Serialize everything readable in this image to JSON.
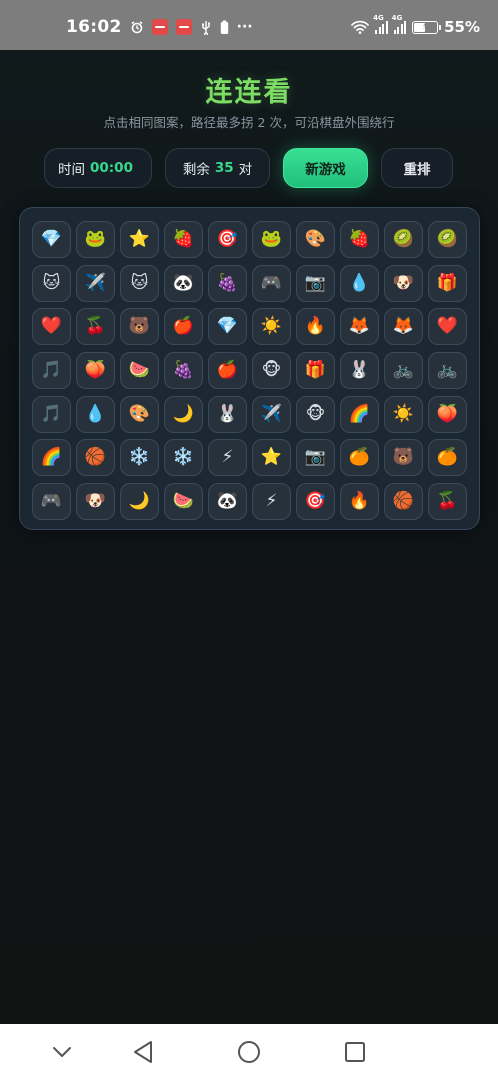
{
  "status_bar": {
    "time": "16:02",
    "more": "···",
    "battery_percent_text": "55%",
    "battery_level": 0.55,
    "signal_1_tag": "4G",
    "signal_2_tag": "4G"
  },
  "header": {
    "title": "连连看",
    "subtitle": "点击相同图案，路径最多拐 2 次，可沿棋盘外围绕行"
  },
  "controls": {
    "time_label": "时间",
    "time_value": "00:00",
    "remaining_prefix": "剩余",
    "remaining_value": "35",
    "remaining_suffix": "对",
    "new_game_label": "新游戏",
    "shuffle_label": "重排"
  },
  "board": {
    "rows": [
      [
        "💎",
        "🐸",
        "⭐",
        "🍓",
        "🎯",
        "🐸",
        "🎨",
        "🍓",
        "🥝",
        "🥝"
      ],
      [
        "🐱",
        "✈️",
        "🐱",
        "🐼",
        "🍇",
        "🎮",
        "📷",
        "💧",
        "🐶",
        "🎁"
      ],
      [
        "❤️",
        "🍒",
        "🐻",
        "🍎",
        "💎",
        "☀️",
        "🔥",
        "🦊",
        "🦊",
        "❤️"
      ],
      [
        "🎵",
        "🍑",
        "🍉",
        "🍇",
        "🍎",
        "🐵",
        "🎁",
        "🐰",
        "🚲",
        "🚲"
      ],
      [
        "🎵",
        "💧",
        "🎨",
        "🌙",
        "🐰",
        "✈️",
        "🐵",
        "🌈",
        "☀️",
        "🍑"
      ],
      [
        "🌈",
        "🏀",
        "❄️",
        "❄️",
        "⚡",
        "⭐",
        "📷",
        "🍊",
        "🐻",
        "🍊"
      ],
      [
        "🎮",
        "🐶",
        "🌙",
        "🍉",
        "🐼",
        "⚡",
        "🎯",
        "🔥",
        "🏀",
        "🍒"
      ]
    ]
  },
  "colors": {
    "title_green": "#7ddc63",
    "accent_green": "#38d98d",
    "board_bg": "#1b2733",
    "tile_bg": "#26313c"
  }
}
